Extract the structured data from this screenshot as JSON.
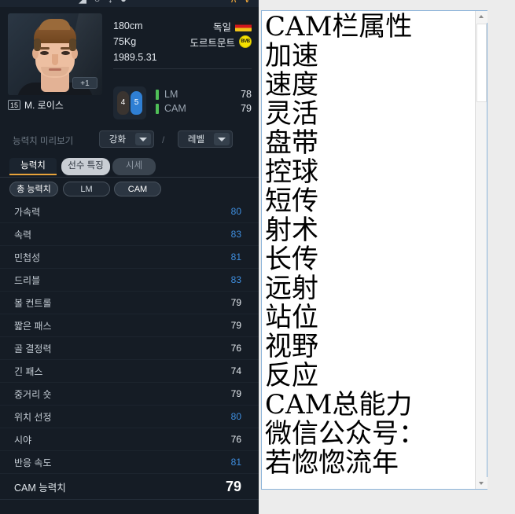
{
  "window": {
    "top_bar_glyphs": "◢ ○ ↓ ● —",
    "top_bar_right": "∧ ∨"
  },
  "player": {
    "name": "M. 로이스",
    "jersey_number": "15",
    "upgrade_badge": "+1",
    "height": "180cm",
    "weight": "75Kg",
    "birthdate": "1989.5.31",
    "nationality": "독일",
    "nationality_flag": "germany-flag-icon",
    "club": "도르트문트",
    "club_crest": "borussia-dortmund-crest-icon",
    "weak_foot": "4",
    "strong_foot": "5",
    "positions": [
      {
        "name": "LM",
        "rating": "78"
      },
      {
        "name": "CAM",
        "rating": "79"
      }
    ]
  },
  "preview": {
    "label": "능력치 미리보기",
    "enhance_value": "강화",
    "separator": "/",
    "level_value": "레벨"
  },
  "tabs": [
    {
      "label": "능력치",
      "active": true
    },
    {
      "label": "선수 특징",
      "active": false
    },
    {
      "label": "시세",
      "active": false
    }
  ],
  "subtabs": [
    {
      "label": "총 능력치",
      "state": "on"
    },
    {
      "label": "LM",
      "state": "off"
    },
    {
      "label": "CAM",
      "state": "off"
    }
  ],
  "stats": [
    {
      "name": "가속력",
      "value": "80",
      "highlight": true
    },
    {
      "name": "속력",
      "value": "83",
      "highlight": true
    },
    {
      "name": "민첩성",
      "value": "81",
      "highlight": true
    },
    {
      "name": "드리블",
      "value": "83",
      "highlight": true
    },
    {
      "name": "볼 컨트롤",
      "value": "79",
      "highlight": false
    },
    {
      "name": "짧은 패스",
      "value": "79",
      "highlight": false
    },
    {
      "name": "골 결정력",
      "value": "76",
      "highlight": false
    },
    {
      "name": "긴 패스",
      "value": "74",
      "highlight": false
    },
    {
      "name": "중거리 숏",
      "value": "79",
      "highlight": false
    },
    {
      "name": "위치 선정",
      "value": "80",
      "highlight": true
    },
    {
      "name": "시야",
      "value": "76",
      "highlight": false
    },
    {
      "name": "반응 속도",
      "value": "81",
      "highlight": true
    }
  ],
  "stat_total": {
    "name": "CAM 능력치",
    "value": "79"
  },
  "notepad": {
    "lines": [
      "CAM栏属性",
      "加速",
      "速度",
      "灵活",
      "盘带",
      "控球",
      "短传",
      "射术",
      "长传",
      "远射",
      "站位",
      "视野",
      "反应",
      "CAM总能力",
      "微信公众号：",
      "若惚惚流年"
    ]
  },
  "colors": {
    "panel_bg": "#151c25",
    "highlight_blue": "#3f8fe0",
    "accent_amber": "#e8a33a",
    "position_green": "#4fbf57",
    "textbox_border": "#8bb3d9"
  }
}
